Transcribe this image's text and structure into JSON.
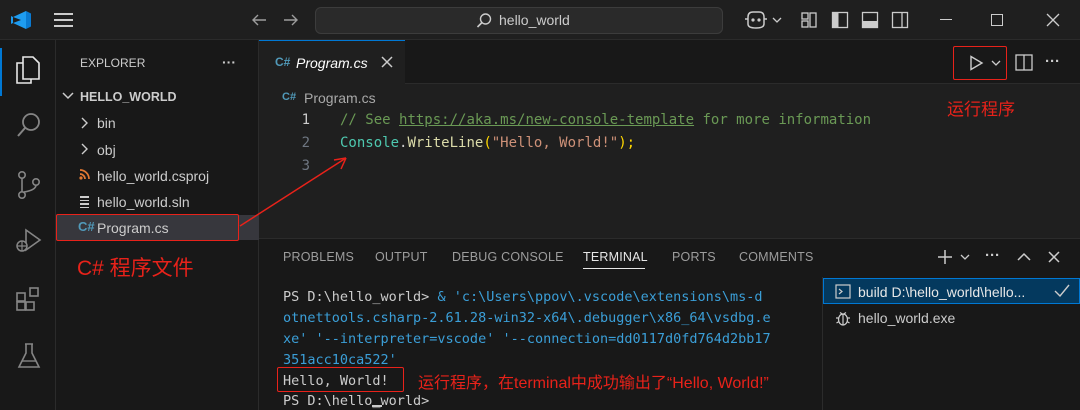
{
  "titlebar": {
    "search_text": "hello_world"
  },
  "explorer": {
    "title": "EXPLORER",
    "more": "···",
    "folder": "HELLO_WORLD",
    "items": [
      {
        "label": "bin",
        "kind": "folder"
      },
      {
        "label": "obj",
        "kind": "folder"
      },
      {
        "label": "hello_world.csproj",
        "kind": "csproj"
      },
      {
        "label": "hello_world.sln",
        "kind": "sln"
      },
      {
        "label": "Program.cs",
        "kind": "cs"
      }
    ]
  },
  "editor": {
    "tab_label": "Program.cs",
    "breadcrumb": "Program.cs",
    "lines": [
      {
        "num": "1"
      },
      {
        "num": "2"
      },
      {
        "num": "3"
      }
    ],
    "code": {
      "comment_prefix": "// See ",
      "comment_url": "https://aka.ms/new-console-template",
      "comment_suffix": " for more information",
      "class_name": "Console",
      "dot": ".",
      "method": "WriteLine",
      "paren_open": "(",
      "string_lit": "\"Hello, World!\"",
      "paren_close": ");"
    }
  },
  "panel": {
    "tabs": [
      "PROBLEMS",
      "OUTPUT",
      "DEBUG CONSOLE",
      "TERMINAL",
      "PORTS",
      "COMMENTS"
    ],
    "active_tab": "TERMINAL",
    "terminal": {
      "prompt1": "PS D:\\hello_world>",
      "cmd_part1": " & 'c:\\Users\\ppov\\.vscode\\extensions\\ms-d",
      "cmd_part2": "otnettools.csharp-2.61.28-win32-x64\\.debugger\\x86_64\\vsdbg.e",
      "cmd_part3": "xe' '--interpreter=vscode' '--connection=dd0117d0fd764d2bb17",
      "cmd_part4": "351acc10ca522'",
      "output": "Hello, World!",
      "prompt2": "PS D:\\hello_world>"
    },
    "sessions": [
      {
        "label": "build D:\\hello_world\\hello..."
      },
      {
        "label": "hello_world.exe"
      }
    ]
  },
  "annotations": {
    "run_program": "运行程序",
    "cs_file": "C# 程序文件",
    "terminal_note": "运行程序，在terminal中成功输出了“Hello, World!”"
  },
  "colors": {
    "accent": "#0078d4",
    "annotation": "#e8221a",
    "comment": "#6a9955",
    "class": "#4ec9b0",
    "method": "#dcdcaa",
    "string": "#ce9178",
    "terminal_string": "#3b9fd8"
  }
}
